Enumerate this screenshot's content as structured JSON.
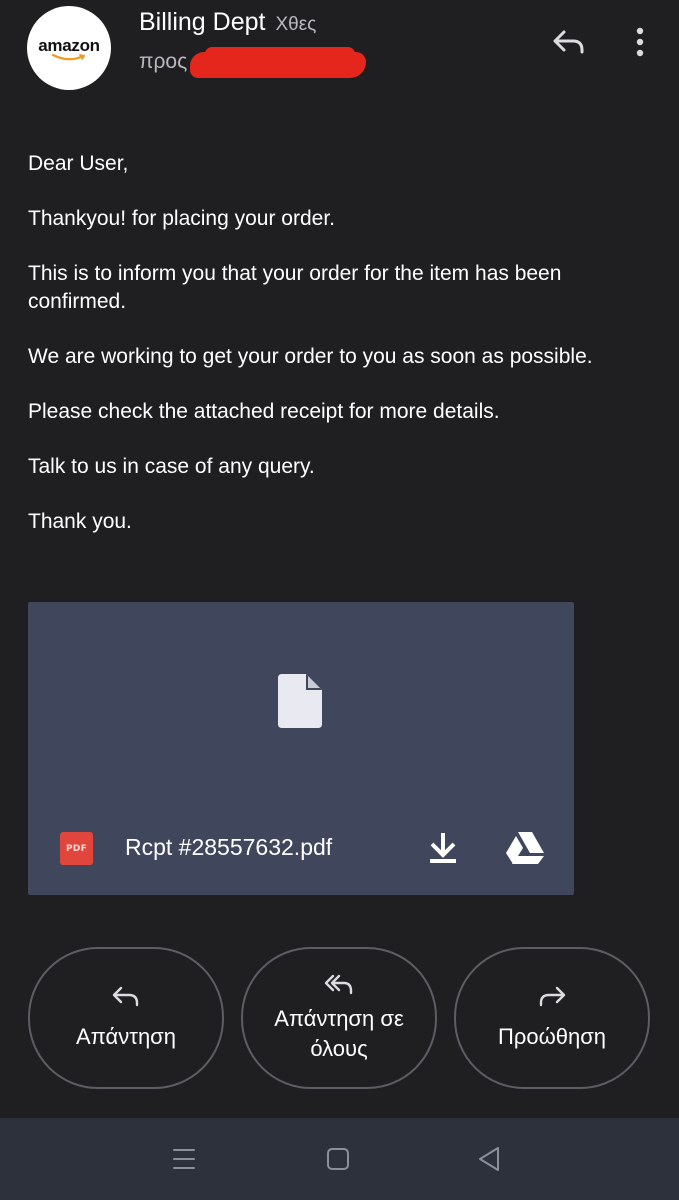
{
  "header": {
    "avatar_logo_text": "amazon",
    "sender_name": "Billing Dept",
    "date": "Χθες",
    "recipient_prefix": "προς"
  },
  "email": {
    "greeting": "Dear User,",
    "paragraphs": [
      "Thankyou! for placing your order.",
      "This is to inform you that your order for the item has been confirmed.",
      "We are working to get your order to you as soon as possible.",
      "Please check the attached receipt for more details.",
      "Talk to us in case of any query.",
      "Thank you."
    ]
  },
  "attachment": {
    "badge": "PDF",
    "file_name": "Rcpt #28557632.pdf",
    "icons": [
      "file-icon",
      "pdf-icon",
      "download-icon",
      "drive-icon"
    ]
  },
  "actions": [
    {
      "label": "Απάντηση",
      "icon": "reply-icon"
    },
    {
      "label": "Απάντηση σε όλους",
      "icon": "reply-all-icon"
    },
    {
      "label": "Προώθηση",
      "icon": "forward-icon"
    }
  ],
  "navbar": {
    "icons": [
      "menu-icon",
      "home-icon",
      "back-icon"
    ]
  },
  "colors": {
    "background": "#1f1f22",
    "attachment_bg": "#40465b",
    "redaction": "#e5261c",
    "pdf_badge": "#e0463c",
    "navbar": "#2c313c"
  }
}
